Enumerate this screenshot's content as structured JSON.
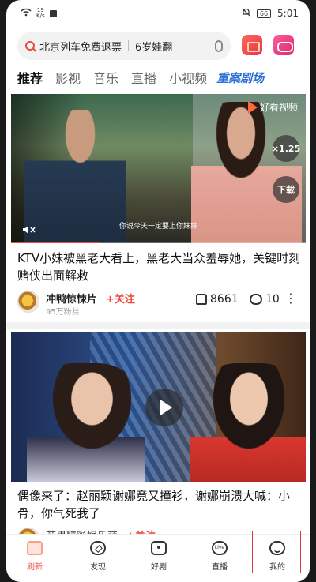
{
  "status_bar": {
    "speed": "19",
    "speed_unit": "K/s",
    "battery": "66",
    "time": "5:01"
  },
  "search": {
    "query_primary": "北京列车免费退票",
    "query_secondary": "6岁娃翻",
    "search_icon": "search-icon",
    "mic_icon": "mic-icon"
  },
  "tabs": [
    {
      "label": "推荐",
      "active": true
    },
    {
      "label": "影视",
      "active": false
    },
    {
      "label": "音乐",
      "active": false
    },
    {
      "label": "直播",
      "active": false
    },
    {
      "label": "小视频",
      "active": false
    },
    {
      "label": "重案剧场",
      "active": false
    }
  ],
  "feed": [
    {
      "logo_text": "好看视频",
      "speed_label": "×1.25",
      "download_label": "下载",
      "subtitle": "你说今天一定要上你妹妹",
      "progress_percent": 30,
      "title": "KTV小妹被黑老大看上，黑老大当众羞辱她，关键时刻赌侠出面解救",
      "author": "冲鸭惊悚片",
      "follow_label": "+关注",
      "fans": "95万粉丝",
      "likes": "8661",
      "comments": "10",
      "more_icon": "more-icon"
    },
    {
      "title": "偶像来了：赵丽颖谢娜竟又撞衫，谢娜崩溃大喊：小骨，你气死我了",
      "author": "芒果精彩娱乐萌",
      "follow_label": "+关注"
    }
  ],
  "bottom_nav": [
    {
      "label": "刷新",
      "icon": "home-icon",
      "active": true
    },
    {
      "label": "发现",
      "icon": "compass-icon",
      "active": false
    },
    {
      "label": "好剧",
      "icon": "tv-icon",
      "active": false
    },
    {
      "label": "直播",
      "icon": "live-icon",
      "active": false
    },
    {
      "label": "我的",
      "icon": "smile-icon",
      "active": false
    }
  ],
  "colors": {
    "accent": "#e84a3c",
    "brand_blue": "#2a6fd6",
    "highlight_box": "#e23b3b"
  }
}
